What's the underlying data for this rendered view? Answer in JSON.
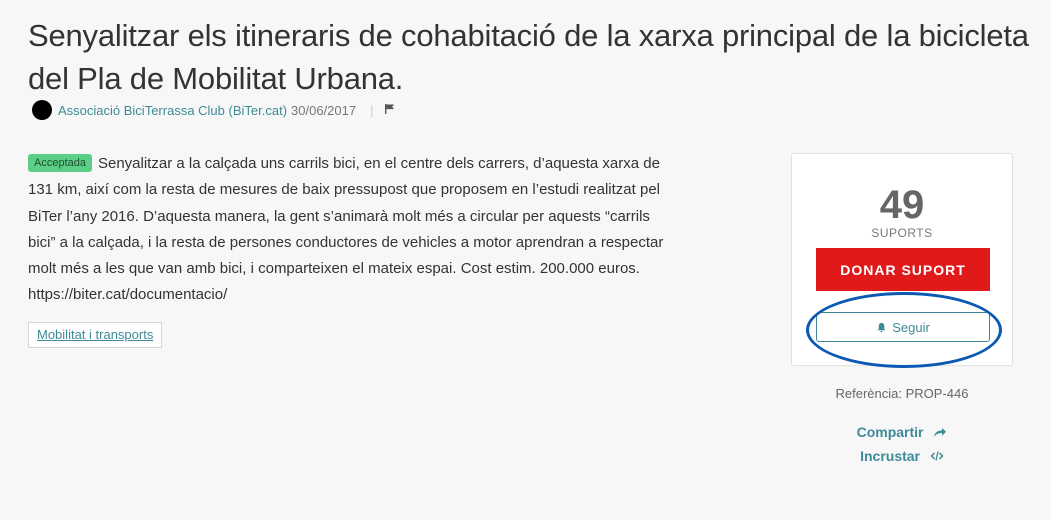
{
  "proposal": {
    "title": "Senyalitzar els itineraris de cohabitació de la xarxa principal de la bicicleta del Pla de Mobilitat Urbana.",
    "author": "Associació BiciTerrassa Club (BiTer.cat)",
    "date": "30/06/2017",
    "status_badge": "Acceptada",
    "body": "Senyalitzar a la calçada uns carrils bici, en el centre dels carrers, d’aquesta xarxa de 131 km, així com la resta de mesures de baix pressupost que proposem en l’estudi realitzat pel BiTer l’any 2016. D’aquesta manera, la gent s’animarà molt més a circular per aquests “carrils bici” a la calçada, i la resta de persones conductores de vehicles a motor aprendran a respectar molt més a les que van amb bici, i comparteixen el mateix espai. Cost estim. 200.000 euros. https://biter.cat/documentacio/",
    "tag": "Mobilitat i transports"
  },
  "support_card": {
    "count": "49",
    "count_label": "SUPORTS",
    "support_button": "DONAR SUPORT",
    "follow_button": "Seguir"
  },
  "sidebar": {
    "reference": "Referència: PROP-446",
    "share": "Compartir",
    "embed": "Incrustar"
  },
  "icons": {
    "avatar": "avatar",
    "flag": "flag-icon",
    "bell": "bell-icon",
    "share": "share-arrow-icon",
    "embed": "code-icon"
  },
  "colors": {
    "accent": "#3f8a98",
    "support_button": "#e01a1a",
    "badge": "#5ccf87",
    "highlight": "#0b59b3"
  }
}
